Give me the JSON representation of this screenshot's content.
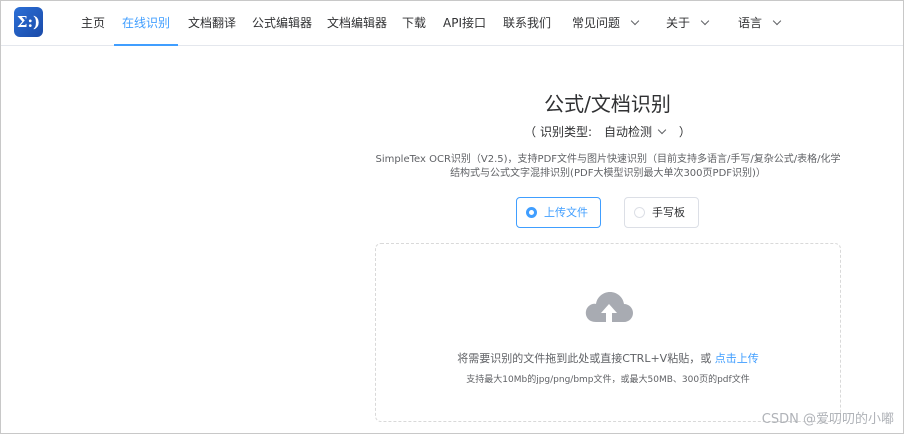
{
  "nav": {
    "logo_text": "Σ:)",
    "items": [
      {
        "label": "主页"
      },
      {
        "label": "在线识别"
      },
      {
        "label": "文档翻译"
      },
      {
        "label": "公式编辑器"
      },
      {
        "label": "文档编辑器"
      },
      {
        "label": "下载"
      },
      {
        "label": "API接口"
      },
      {
        "label": "联系我们"
      },
      {
        "label": "常见问题"
      },
      {
        "label": "关于"
      },
      {
        "label": "语言"
      }
    ],
    "active_item": "在线识别",
    "accent_color": "#409eff"
  },
  "main": {
    "title": "公式/文档识别",
    "type_label": "（ 识别类型:",
    "type_value": "自动检测",
    "type_close": "）",
    "description": "SimpleTex OCR识别（V2.5)，支持PDF文件与图片快速识别（目前支持多语言/手写/复杂公式/表格/化学结构式与公式文字混排识别(PDF大模型识别最大单次300页PDF识别)）",
    "modes": [
      {
        "label": "上传文件",
        "checked": true
      },
      {
        "label": "手写板",
        "checked": false
      }
    ],
    "upload": {
      "icon": "cloud-upload-icon",
      "text": "将需要识别的文件拖到此处或直接CTRL+V粘贴，或",
      "link": "点击上传",
      "tip": "支持最大10Mb的jpg/png/bmp文件，或最大50MB、300页的pdf文件"
    }
  },
  "watermark": "CSDN @爱叨叨的小嘟"
}
